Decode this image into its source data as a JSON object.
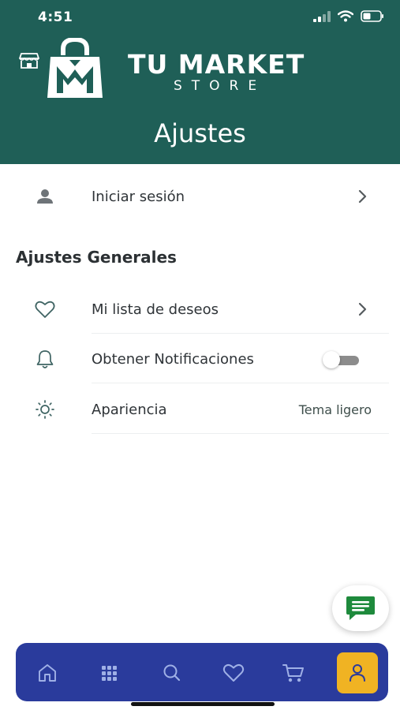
{
  "status_bar": {
    "time": "4:51"
  },
  "brand": {
    "name": "TU MARKET",
    "sub": "STORE",
    "mark_letter": "M"
  },
  "header": {
    "title": "Ajustes"
  },
  "login": {
    "label": "Iniciar sesión"
  },
  "section": {
    "title": "Ajustes Generales"
  },
  "settings": {
    "wishlist": {
      "label": "Mi lista de deseos"
    },
    "notifications": {
      "label": "Obtener Notificaciones",
      "enabled": false
    },
    "appearance": {
      "label": "Apariencia",
      "value": "Tema ligero"
    }
  },
  "bottom_nav": {
    "items": [
      {
        "icon": "home-icon"
      },
      {
        "icon": "grid-icon"
      },
      {
        "icon": "search-icon"
      },
      {
        "icon": "heart-icon"
      },
      {
        "icon": "cart-icon"
      },
      {
        "icon": "user-icon",
        "active": true
      }
    ]
  },
  "colors": {
    "header": "#1f5f57",
    "nav": "#2a3b9c",
    "nav_active": "#f0b323",
    "chat": "#1e8a3c"
  }
}
